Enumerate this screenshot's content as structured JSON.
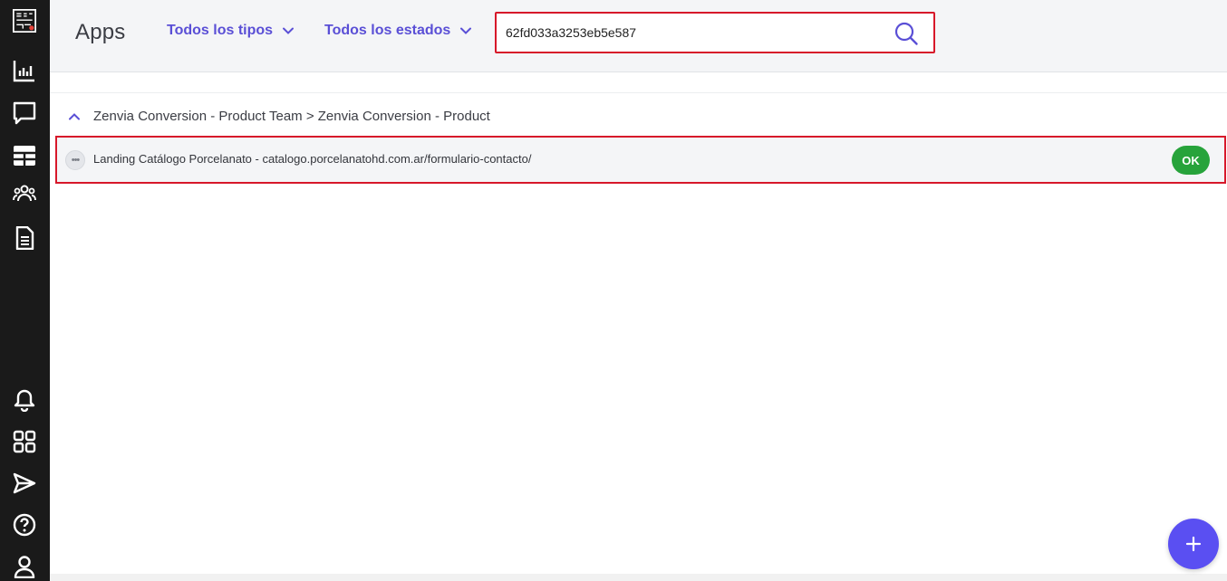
{
  "header": {
    "title": "Apps",
    "filter_types": "Todos los tipos",
    "filter_states": "Todos los estados",
    "search_value": "62fd033a3253eb5e587"
  },
  "group": {
    "label": "Zenvia Conversion - Product Team > Zenvia Conversion - Product"
  },
  "rows": [
    {
      "text": "Landing Catálogo Porcelanato - catalogo.porcelanatohd.com.ar/formulario-contacto/",
      "status": "OK",
      "menu": "•••"
    }
  ],
  "colors": {
    "accent": "#5a4fd6",
    "ok": "#27a33b",
    "highlight": "#d7182a",
    "sidebar": "#1a1a1a"
  },
  "icons": [
    "logo-icon",
    "analytics-icon",
    "chat-icon",
    "table-icon",
    "users-icon",
    "document-icon",
    "bell-icon",
    "apps-grid-icon",
    "send-icon",
    "help-icon",
    "user-icon",
    "search-icon",
    "chevron-down-icon",
    "chevron-up-icon",
    "plus-icon"
  ]
}
